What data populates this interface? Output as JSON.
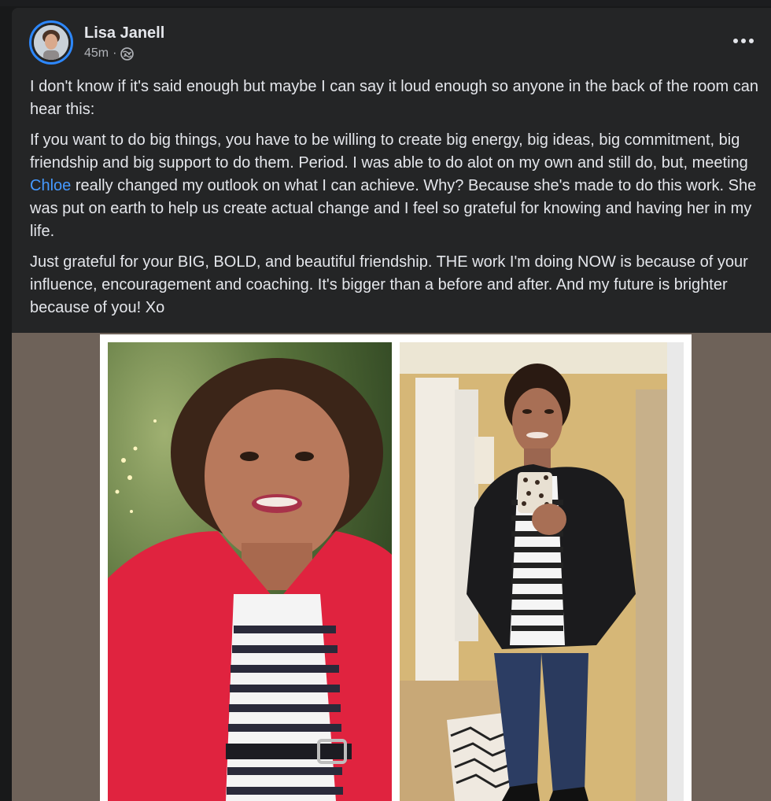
{
  "post": {
    "author_name": "Lisa Janell",
    "time": "45m",
    "separator": "·",
    "audience_icon": "globe-icon",
    "more_icon": "more-dots-icon",
    "paragraphs": {
      "p1": "I don't know if it's said enough but maybe I can say it loud enough so anyone in the back of the room can hear this:",
      "p2_before": "If you want to do big things, you have to be willing to create big energy, big ideas, big commitment, big friendship and big support to do them. Period. I was able to do alot on my own and still do, but, meeting ",
      "p2_mention": "Chloe",
      "p2_after": " really changed my outlook on what I can achieve. Why? Because she's made to do this work. She was put on earth to help us create actual change and I feel so grateful for knowing and having her in my life.",
      "p3": "Just grateful for your BIG, BOLD, and beautiful friendship. THE work I'm doing NOW is because of your influence, encouragement and coaching. It's bigger than a before and after. And my future is brighter because of you! Xo"
    }
  },
  "colors": {
    "card_bg": "#242526",
    "text": "#e4e6eb",
    "secondary_text": "#b0b3b8",
    "mention": "#4599ff",
    "avatar_ring": "#2d88ff",
    "media_bg": "#6e6259"
  }
}
